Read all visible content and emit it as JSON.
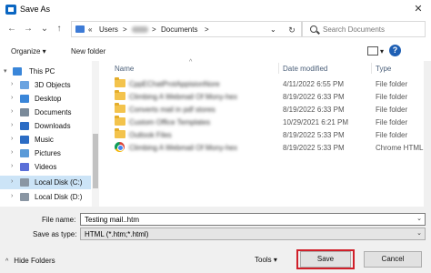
{
  "window": {
    "title": "Save As",
    "close_glyph": "✕"
  },
  "nav": {
    "back": "←",
    "forward": "→",
    "up_menu": "⌄",
    "up": "↑"
  },
  "address": {
    "prefix": "«",
    "segments": [
      "Users",
      ">",
      ">",
      "Documents",
      ">"
    ],
    "dropdown": "⌄",
    "refresh": "↻"
  },
  "search": {
    "placeholder": "Search Documents"
  },
  "toolbar": {
    "organize": "Organize ▾",
    "new_folder": "New folder",
    "view_menu": "▾",
    "help": "?"
  },
  "sidebar": {
    "items": [
      {
        "label": "This PC",
        "expander": "▾",
        "icon": "pc-icon",
        "color": "#3a86d9",
        "selected": false
      },
      {
        "label": "3D Objects",
        "expander": "›",
        "icon": "3d-objects-icon",
        "color": "#6aa3e0",
        "selected": false
      },
      {
        "label": "Desktop",
        "expander": "›",
        "icon": "desktop-icon",
        "color": "#3a86d9",
        "selected": false
      },
      {
        "label": "Documents",
        "expander": "›",
        "icon": "documents-icon",
        "color": "#7a8a9a",
        "selected": false
      },
      {
        "label": "Downloads",
        "expander": "›",
        "icon": "downloads-icon",
        "color": "#2b6cc4",
        "selected": false
      },
      {
        "label": "Music",
        "expander": "›",
        "icon": "music-icon",
        "color": "#2b6cc4",
        "selected": false
      },
      {
        "label": "Pictures",
        "expander": "›",
        "icon": "pictures-icon",
        "color": "#5a9ad8",
        "selected": false
      },
      {
        "label": "Videos",
        "expander": "›",
        "icon": "videos-icon",
        "color": "#5a6fd8",
        "selected": false
      },
      {
        "label": "Local Disk (C:)",
        "expander": "›",
        "icon": "disk-icon",
        "color": "#8a96a3",
        "selected": true
      },
      {
        "label": "Local Disk (D:)",
        "expander": "›",
        "icon": "disk-icon",
        "color": "#8a96a3",
        "selected": false
      }
    ]
  },
  "columns": {
    "name": "Name",
    "date": "Date modified",
    "type": "Type",
    "sort_indicator": "^"
  },
  "files": [
    {
      "name": "CppEChatProtAppisionNore",
      "date": "4/11/2022 6:55 PM",
      "type": "File folder",
      "icon": "folder-icon"
    },
    {
      "name": "Climbing A Webmail Of Mony-hex",
      "date": "8/19/2022 6:33 PM",
      "type": "File folder",
      "icon": "folder-icon"
    },
    {
      "name": "Converts mail in pdf stores",
      "date": "8/19/2022 6:33 PM",
      "type": "File folder",
      "icon": "folder-icon"
    },
    {
      "name": "Custom Office Templates",
      "date": "10/29/2021 6:21 PM",
      "type": "File folder",
      "icon": "folder-icon"
    },
    {
      "name": "Outlook Files",
      "date": "8/19/2022 5:33 PM",
      "type": "File folder",
      "icon": "folder-icon"
    },
    {
      "name": "Climbing A Webmail Of Mony-hex",
      "date": "8/19/2022 5:33 PM",
      "type": "Chrome HTML D",
      "icon": "chrome-icon"
    }
  ],
  "form": {
    "file_name_label": "File name:",
    "file_name_value": "Testing mail..htm",
    "save_type_label": "Save as type:",
    "save_type_value": "HTML (*.htm;*.html)",
    "dropdown_arrow": "⌄"
  },
  "footer": {
    "hide_folders_chevron": "^",
    "hide_folders": "Hide Folders",
    "tools": "Tools",
    "tools_arrow": "▾",
    "save": "Save",
    "cancel": "Cancel"
  },
  "colors": {
    "highlight": "#cce4f7",
    "save_outline": "#d0202a",
    "folder": "#f3c34c",
    "column_header": "#4c607a"
  }
}
